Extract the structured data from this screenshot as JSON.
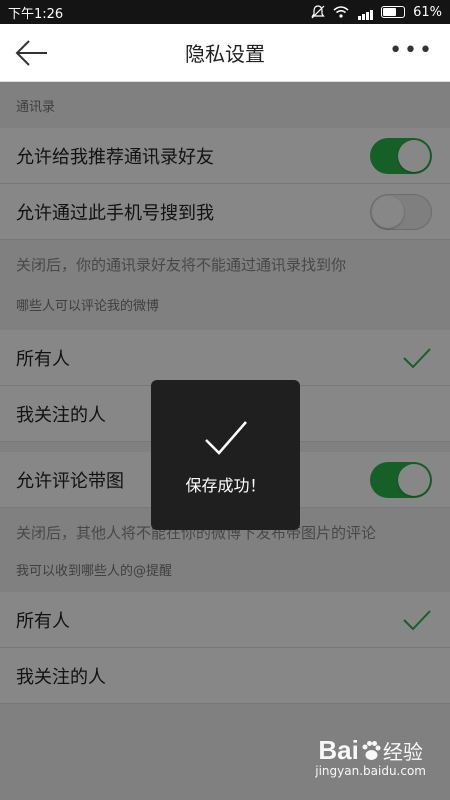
{
  "status": {
    "time": "下午1:26",
    "battery": "61%"
  },
  "header": {
    "title": "隐私设置",
    "more": "•••"
  },
  "contacts": {
    "section_title": "通讯录",
    "rows": [
      {
        "label": "允许给我推荐通讯录好友",
        "toggle": "on"
      },
      {
        "label": "允许通过此手机号搜到我",
        "toggle": "off"
      }
    ],
    "note": "关闭后，你的通讯录好友将不能通过通讯录找到你"
  },
  "comment": {
    "section_title": "哪些人可以评论我的微博",
    "options": [
      {
        "label": "所有人",
        "selected": true
      },
      {
        "label": "我关注的人",
        "selected": false
      }
    ]
  },
  "comment_image": {
    "label": "允许评论带图",
    "toggle": "on",
    "note": "关闭后，其他人将不能在你的微博下发布带图片的评论"
  },
  "mention": {
    "section_title": "我可以收到哪些人的@提醒",
    "options": [
      {
        "label": "所有人",
        "selected": true
      },
      {
        "label": "我关注的人",
        "selected": false
      }
    ]
  },
  "toast": {
    "message": "保存成功！"
  },
  "watermark": {
    "brand": "Bai",
    "brand2": "经验",
    "url": "jingyan.baidu.com"
  },
  "colors": {
    "accent": "#2bb34a",
    "toast_bg": "#1f1f1f"
  }
}
